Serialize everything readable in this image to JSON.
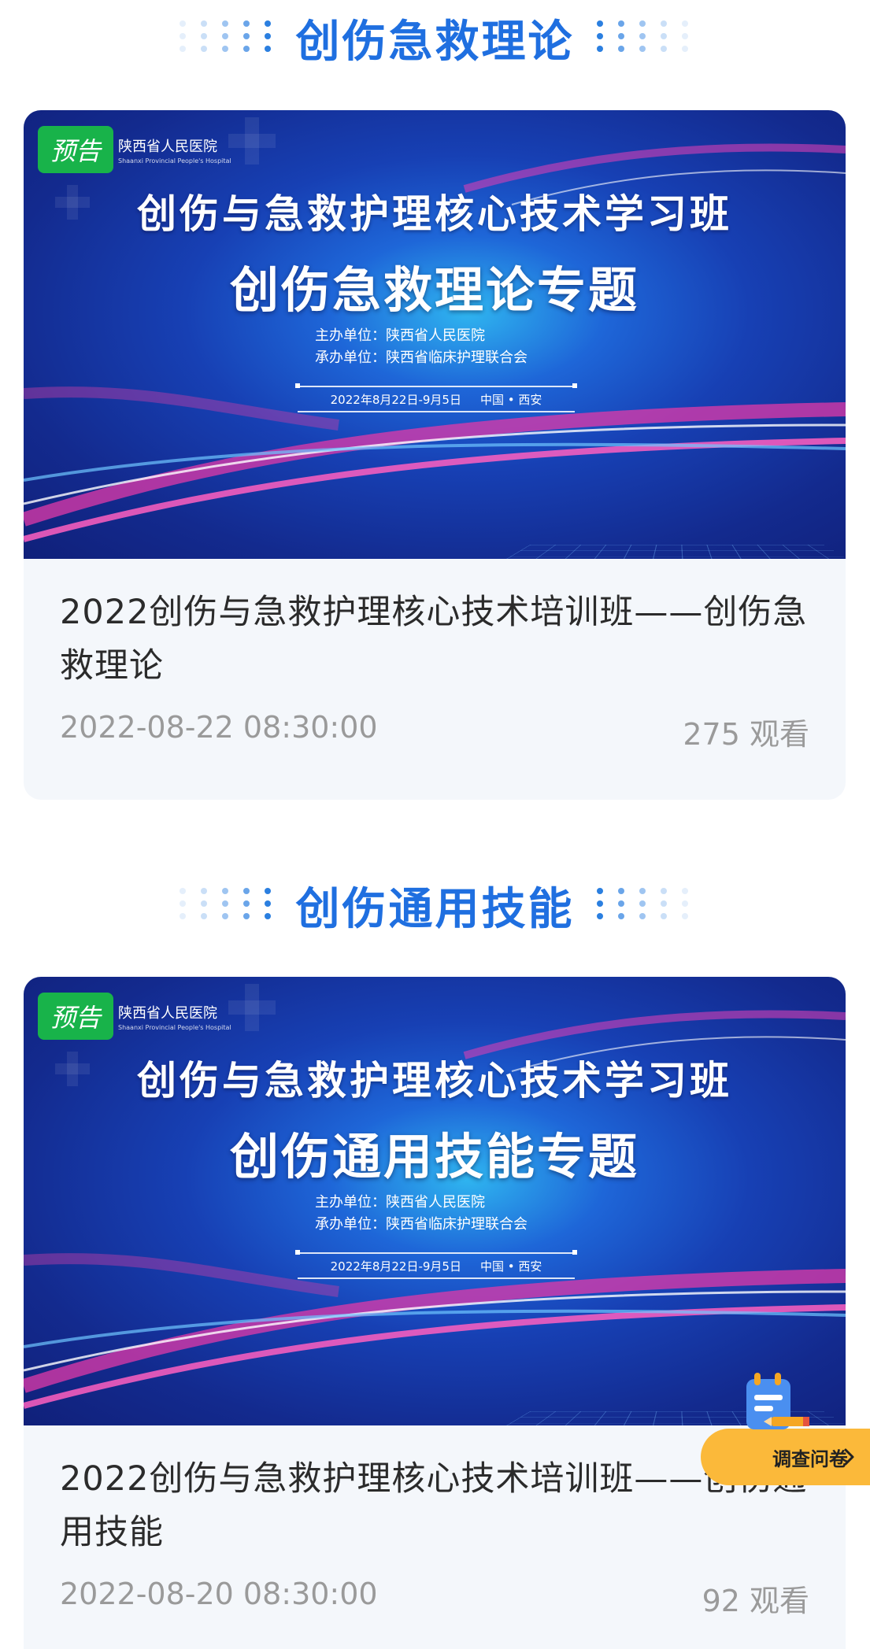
{
  "sections": [
    {
      "title": "创伤急救理论",
      "badge": "预告",
      "logo": "陕西省人民医院",
      "logo_sub": "Shaanxi Provincial People's Hospital",
      "banner_title1": "创伤与急救护理核心技术学习班",
      "banner_title2": "创伤急救理论专题",
      "host": "主办单位：陕西省人民医院",
      "organizer": "承办单位：陕西省临床护理联合会",
      "banner_date": "2022年8月22日-9月5日",
      "banner_place": "中国 • 西安",
      "item_title": "2022创伤与急救护理核心技术培训班——创伤急救理论",
      "datetime": "2022-08-22 08:30:00",
      "views": "275 观看"
    },
    {
      "title": "创伤通用技能",
      "badge": "预告",
      "logo": "陕西省人民医院",
      "logo_sub": "Shaanxi Provincial People's Hospital",
      "banner_title1": "创伤与急救护理核心技术学习班",
      "banner_title2": "创伤通用技能专题",
      "host": "主办单位：陕西省人民医院",
      "organizer": "承办单位：陕西省临床护理联合会",
      "banner_date": "2022年8月22日-9月5日",
      "banner_place": "中国 • 西安",
      "item_title": "2022创伤与急救护理核心技术培训班——创伤通用技能",
      "datetime": "2022-08-20 08:30:00",
      "views": "92 观看"
    }
  ],
  "survey": {
    "label": "调查问卷",
    "icon": "notepad-pencil-icon",
    "chevron": "chevron-right-icon"
  },
  "colors": {
    "accent": "#1f6fe0",
    "badge": "#18b34a",
    "survey": "#fbb93a"
  }
}
